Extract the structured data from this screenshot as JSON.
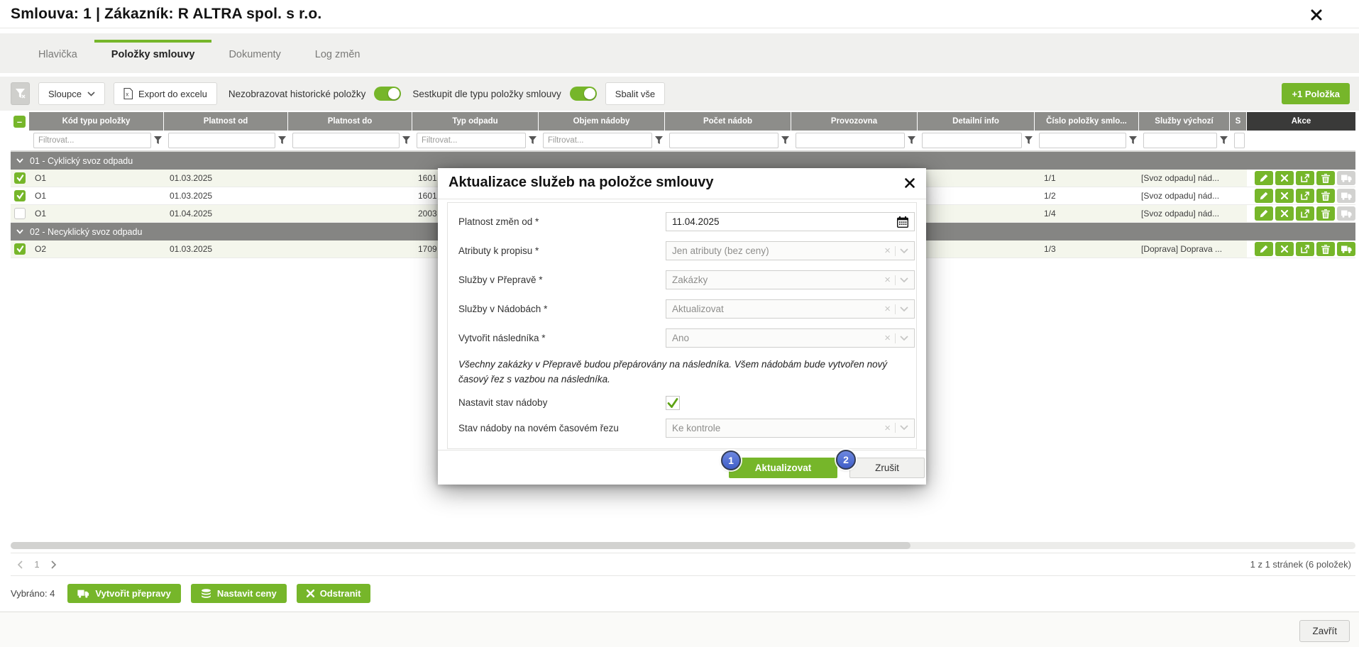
{
  "window": {
    "title": "Smlouva: 1 | Zákazník: R ALTRA spol. s r.o.",
    "close_icon": "close-x"
  },
  "tabs": [
    {
      "label": "Hlavička",
      "active": false
    },
    {
      "label": "Položky smlouvy",
      "active": true
    },
    {
      "label": "Dokumenty",
      "active": false
    },
    {
      "label": "Log změn",
      "active": false
    }
  ],
  "toolbar": {
    "filter_clear_icon": "funnel-with-x",
    "columns_button": "Sloupce",
    "export_button": "Export do excelu",
    "toggle_hide_historical": {
      "label": "Nezobrazovat historické položky",
      "on": true
    },
    "toggle_group_by_type": {
      "label": "Sestkupit dle typu položky smlouvy",
      "on": true
    },
    "collapse_all_button": "Sbalit vše",
    "add_item_button": "+1 Položka"
  },
  "grid": {
    "columns": [
      {
        "type": "select",
        "label": ""
      },
      {
        "label": "Kód typu položky",
        "filter": "Filtrovat..."
      },
      {
        "label": "Platnost od",
        "filter": ""
      },
      {
        "label": "Platnost do",
        "filter": ""
      },
      {
        "label": "Typ odpadu",
        "filter": "Filtrovat..."
      },
      {
        "label": "Objem nádoby",
        "filter": "Filtrovat..."
      },
      {
        "label": "Počet nádob",
        "filter": ""
      },
      {
        "label": "Provozovna",
        "filter": ""
      },
      {
        "label": "Detailní info",
        "filter": ""
      },
      {
        "label": "Číslo položky smlo...",
        "filter": ""
      },
      {
        "label": "Služby výchozí",
        "filter": ""
      },
      {
        "label": "S",
        "filter": ""
      },
      {
        "type": "actions",
        "label": "Akce"
      }
    ],
    "groups": [
      {
        "label": "01 - Cyklický svoz odpadu",
        "rows": [
          {
            "checked": true,
            "cells": [
              "O1",
              "01.03.2025",
              "",
              "1601",
              "",
              "",
              "",
              "",
              "1/1",
              "[Svoz odpadu] nád...",
              ""
            ],
            "truck_enabled": false
          },
          {
            "checked": true,
            "cells": [
              "O1",
              "01.03.2025",
              "",
              "1601",
              "",
              "",
              "",
              "",
              "1/2",
              "[Svoz odpadu] nád...",
              ""
            ],
            "truck_enabled": false
          },
          {
            "checked": false,
            "cells": [
              "O1",
              "01.04.2025",
              "",
              "2003",
              "",
              "",
              "",
              "",
              "1/4",
              "[Svoz odpadu] nád...",
              ""
            ],
            "truck_enabled": false
          }
        ]
      },
      {
        "label": "02 - Necyklický svoz odpadu",
        "rows": [
          {
            "checked": true,
            "cells": [
              "O2",
              "01.03.2025",
              "",
              "1709",
              "",
              "",
              "",
              "",
              "1/3",
              "[Doprava] Doprava ...",
              ""
            ],
            "truck_enabled": true
          }
        ]
      }
    ],
    "action_icons": [
      "pencil-icon",
      "x-icon",
      "open-external-icon",
      "trash-icon",
      "truck-icon"
    ]
  },
  "modal": {
    "title": "Aktualizace služeb na položce smlouvy",
    "close_icon": "close-x",
    "field_date": {
      "label": "Platnost změn od *",
      "value": "11.04.2025",
      "icon": "calendar-icon"
    },
    "field_attrs": {
      "label": "Atributy k propisu *",
      "value": "Jen atributy (bez ceny)"
    },
    "field_transport": {
      "label": "Služby v Přepravě *",
      "value": "Zakázky"
    },
    "field_containers": {
      "label": "Služby v Nádobách *",
      "value": "Aktualizovat"
    },
    "field_successor": {
      "label": "Vytvořit následníka *",
      "value": "Ano"
    },
    "note": "Všechny zakázky v Přepravě budou přepárovány na následníka. Všem nádobám bude vytvořen nový časový řez s vazbou na následníka.",
    "field_set_state": {
      "label": "Nastavit stav nádoby",
      "checked": true
    },
    "field_state": {
      "label": "Stav nádoby na novém časovém řezu",
      "value": "Ke kontrole"
    },
    "update_button": "Aktualizovat",
    "cancel_button": "Zrušit",
    "annotations": {
      "update": "1",
      "cancel": "2"
    }
  },
  "footer": {
    "pagination": {
      "prev_icon": "chevron-left",
      "page": "1",
      "next_icon": "chevron-right",
      "info": "1 z 1 stránek (6 položek)"
    },
    "selection": {
      "label": "Vybráno: 4",
      "create_transports_button": "Vytvořit přepravy",
      "set_prices_button": "Nastavit ceny",
      "remove_button": "Odstranit"
    },
    "close_button": "Zavřít"
  },
  "colors": {
    "accent": "#76b62a",
    "annotation_badge": "#4a6cd3",
    "header": "#8d8d8a",
    "actions_header": "#3a3a39"
  }
}
